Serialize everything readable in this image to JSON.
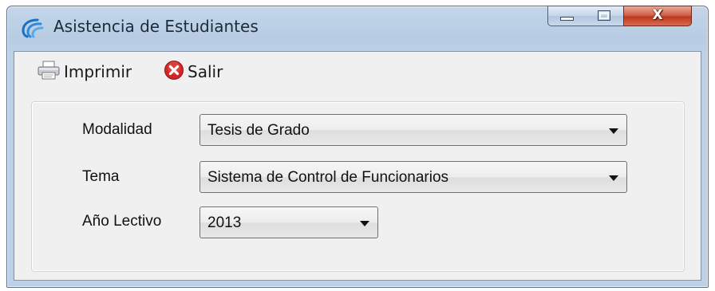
{
  "window": {
    "title": "Asistencia de Estudiantes",
    "controls": {
      "close_glyph": "X"
    },
    "icon": "app-swirl-icon"
  },
  "toolbar": {
    "print_label": "Imprimir",
    "print_icon": "printer-icon",
    "exit_label": "Salir",
    "exit_icon": "close-circle-icon"
  },
  "form": {
    "modalidad_label": "Modalidad",
    "modalidad_value": "Tesis de Grado",
    "tema_label": "Tema",
    "tema_value": "Sistema de Control de Funcionarios",
    "anio_label": "Año Lectivo",
    "anio_value": "2013"
  },
  "colors": {
    "titlebar": "#bcd0e6",
    "close_button": "#c0391e",
    "client_bg": "#f0f0f0"
  }
}
